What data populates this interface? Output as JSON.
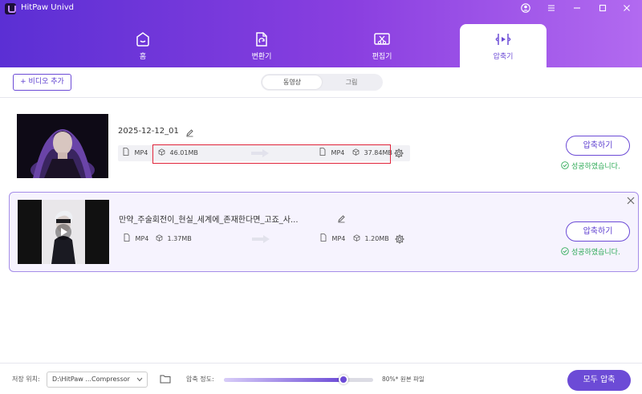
{
  "app": {
    "title": "HitPaw Univd"
  },
  "tabs": [
    {
      "label": "홈",
      "icon": "home-icon"
    },
    {
      "label": "변환기",
      "icon": "converter-icon"
    },
    {
      "label": "편집기",
      "icon": "editor-icon"
    },
    {
      "label": "압축기",
      "icon": "compressor-icon",
      "active": true
    }
  ],
  "toolbar": {
    "add_video_label": "+ 비디오 추가",
    "segments": [
      {
        "label": "동영상",
        "active": true
      },
      {
        "label": "그림",
        "active": false
      }
    ]
  },
  "files": [
    {
      "name": "2025-12-12_01",
      "src_format": "MP4",
      "src_size": "46.01MB",
      "dst_format": "MP4",
      "dst_size": "37.84MB",
      "button_label": "압축하기",
      "status": "성공하였습니다."
    },
    {
      "name": "만약_주술회전이_현실_세계에_존재한다면_고죠_사...",
      "src_format": "MP4",
      "src_size": "1.37MB",
      "dst_format": "MP4",
      "dst_size": "1.20MB",
      "button_label": "압축하기",
      "status": "성공하였습니다."
    }
  ],
  "bottom": {
    "save_location_label": "저장 위치:",
    "save_path": "D:\\HitPaw ...Compressor",
    "quality_label": "압축 정도:",
    "quality_value": "80%* 원본 파일",
    "quality_fraction": 0.8,
    "compress_all_label": "모두 압축"
  },
  "colors": {
    "accent": "#6c4bd6",
    "success": "#2daa56",
    "highlight": "#e0243a"
  }
}
